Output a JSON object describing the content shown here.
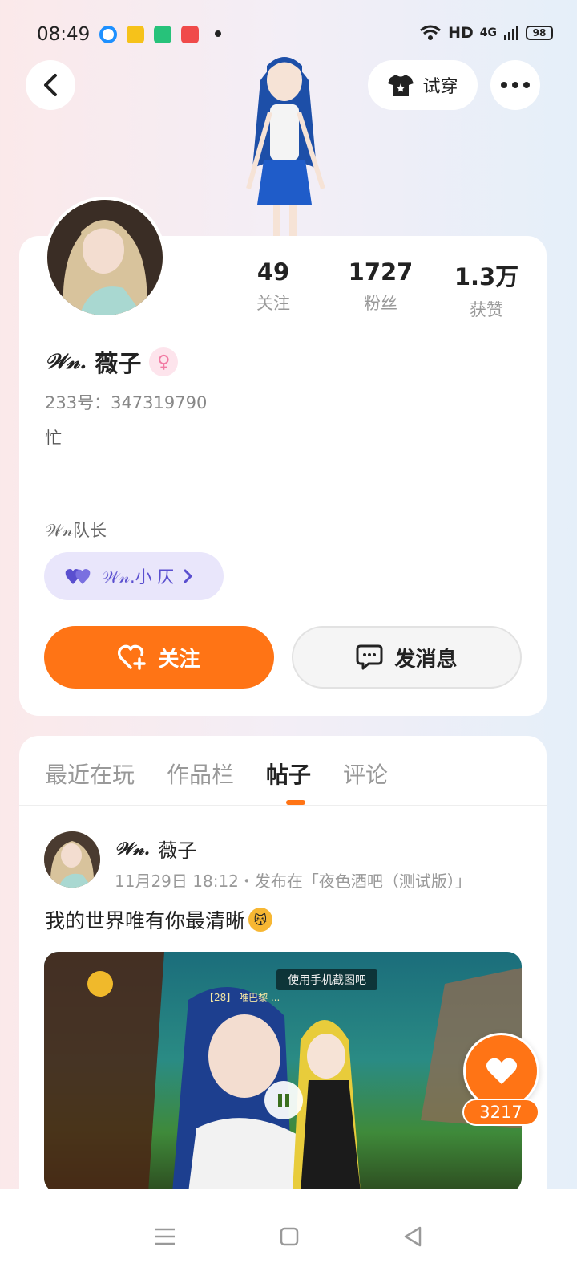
{
  "status_bar": {
    "time": "08:49",
    "network": "HD",
    "signal": "4G",
    "battery": "98"
  },
  "header": {
    "try_on_label": "试穿"
  },
  "profile": {
    "name_prefix": "𝒲𝓃.",
    "name": "薇子",
    "gender_icon": "female-icon",
    "uid": "233号：347319790",
    "bio": "忙",
    "team_role": "𝒲𝓃队长",
    "team_chip_label": "𝒲𝓃.小  仄",
    "stats": [
      {
        "value": "49",
        "label": "关注"
      },
      {
        "value": "1727",
        "label": "粉丝"
      },
      {
        "value": "1.3万",
        "label": "获赞"
      }
    ],
    "follow_label": "关注",
    "message_label": "发消息"
  },
  "tabs": [
    {
      "label": "最近在玩",
      "active": false
    },
    {
      "label": "作品栏",
      "active": false
    },
    {
      "label": "帖子",
      "active": true
    },
    {
      "label": "评论",
      "active": false
    }
  ],
  "post": {
    "author_prefix": "𝒲𝓃.",
    "author": "薇子",
    "meta": "11月29日 18:12・发布在「夜色酒吧（测试版）」",
    "text": "我的世界唯有你最清晰",
    "media_caption": "使用手机截图吧",
    "media_sub": "【28】 唯巴黎 ..."
  },
  "like_count": "3217",
  "colors": {
    "accent": "#ff7415",
    "team_chip_bg": "#e9e6fb",
    "team_chip_text": "#5a4fcf",
    "gender_pink": "#f27aa3"
  }
}
